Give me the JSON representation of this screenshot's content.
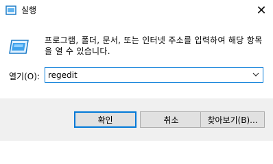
{
  "window": {
    "title": "실행",
    "close_glyph": "✕",
    "icon": "run-dialog-icon"
  },
  "description": "프로그램, 폴더, 문서, 또는 인터넷 주소를 입력하여 해당 항목을 열 수 있습니다.",
  "open_field": {
    "label": "열기(O):",
    "value": "regedit",
    "dropdown_icon": "chevron-down-icon"
  },
  "buttons": {
    "ok": "확인",
    "cancel": "취소",
    "browse": "찾아보기(B)..."
  },
  "colors": {
    "accent": "#0078d7",
    "footer_bg": "#f0f0f0",
    "button_bg": "#e1e1e1"
  }
}
